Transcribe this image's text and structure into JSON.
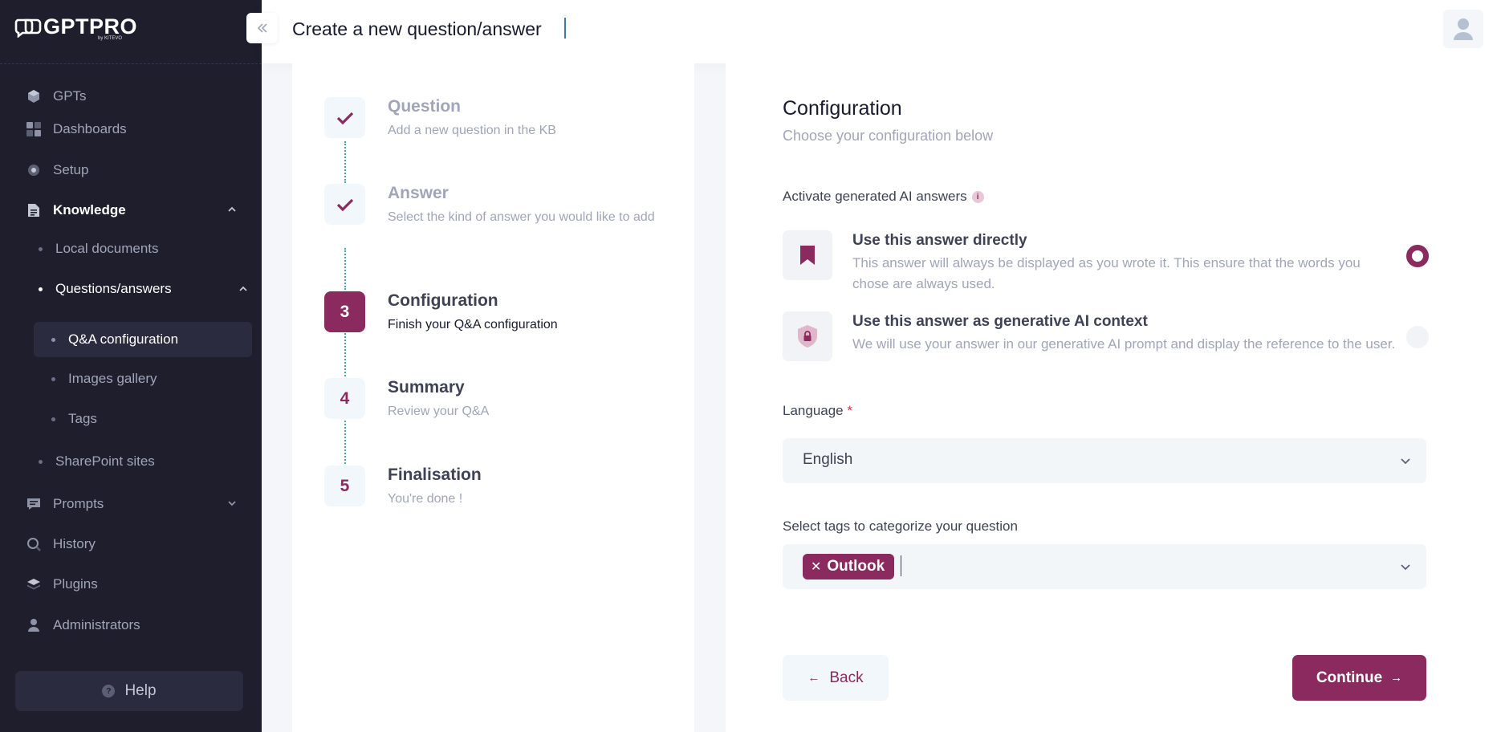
{
  "app": {
    "logo_text": "GPTPRO",
    "logo_by": "by KITEVO"
  },
  "header": {
    "title": "Create a new question/answer"
  },
  "sidebar": {
    "items": [
      {
        "label": "GPTs",
        "icon": "cube-icon"
      },
      {
        "label": "Dashboards",
        "icon": "dashboard-grid-icon"
      },
      {
        "label": "Setup",
        "icon": "gear-icon"
      },
      {
        "label": "Knowledge",
        "icon": "document-icon"
      },
      {
        "label": "Prompts",
        "icon": "chat-icon"
      },
      {
        "label": "History",
        "icon": "search-history-icon"
      },
      {
        "label": "Plugins",
        "icon": "layers-icon"
      },
      {
        "label": "Administrators",
        "icon": "user-icon"
      }
    ],
    "knowledge_sub": [
      {
        "label": "Local documents"
      },
      {
        "label": "Questions/answers"
      },
      {
        "label": "SharePoint sites"
      }
    ],
    "qa_sub": [
      {
        "label": "Q&A configuration"
      },
      {
        "label": "Images gallery"
      },
      {
        "label": "Tags"
      }
    ],
    "help_label": "Help"
  },
  "steps": [
    {
      "number": "1",
      "title": "Question",
      "desc": "Add a new question in the KB",
      "state": "done"
    },
    {
      "number": "2",
      "title": "Answer",
      "desc": "Select the kind of answer you would like to add",
      "state": "done"
    },
    {
      "number": "3",
      "title": "Configuration",
      "desc": "Finish your Q&A configuration",
      "state": "current"
    },
    {
      "number": "4",
      "title": "Summary",
      "desc": "Review your Q&A",
      "state": "pending"
    },
    {
      "number": "5",
      "title": "Finalisation",
      "desc": "You're done !",
      "state": "pending"
    }
  ],
  "config": {
    "title": "Configuration",
    "subtitle": "Choose your configuration below",
    "ai_label": "Activate generated AI answers",
    "options": [
      {
        "title": "Use this answer directly",
        "desc": "This answer will always be displayed as you wrote it. This ensure that the words you chose are always used.",
        "selected": true
      },
      {
        "title": "Use this answer as generative AI context",
        "desc": "We will use your answer in our generative AI prompt and display the reference to the user.",
        "selected": false
      }
    ],
    "language_label": "Language",
    "language_required": "*",
    "language_value": "English",
    "tags_label": "Select tags to categorize your question",
    "tags": [
      "Outlook"
    ],
    "back_label": "Back",
    "continue_label": "Continue"
  },
  "colors": {
    "brand": "#8a2a5e",
    "sidebar_bg": "#1e1e2d",
    "connector": "#4da6a8"
  }
}
